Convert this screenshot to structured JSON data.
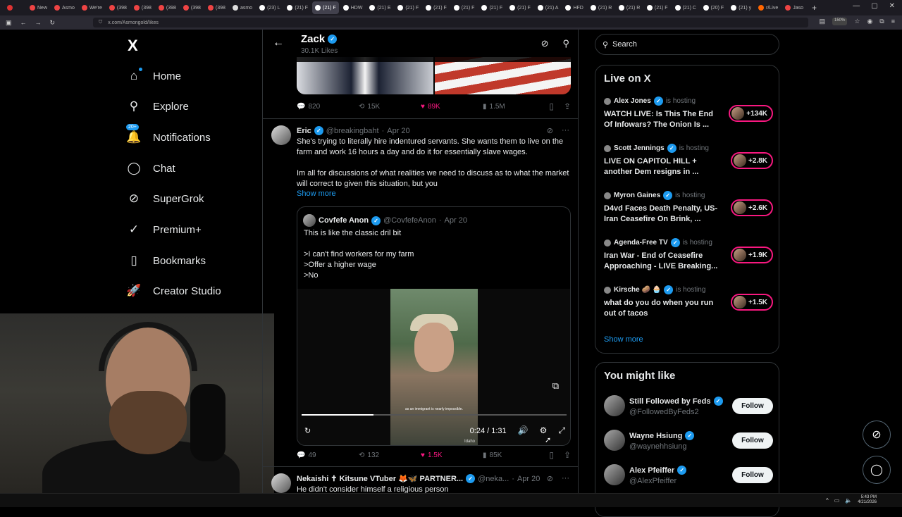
{
  "browser": {
    "tabs": [
      {
        "label": "",
        "color": "#d33"
      },
      {
        "label": "New",
        "color": "#e44"
      },
      {
        "label": "Asmo",
        "color": "#e44"
      },
      {
        "label": "We're",
        "color": "#e44"
      },
      {
        "label": "(398",
        "color": "#e44"
      },
      {
        "label": "(398",
        "color": "#e44"
      },
      {
        "label": "(398",
        "color": "#e44"
      },
      {
        "label": "(398",
        "color": "#e44"
      },
      {
        "label": "(398",
        "color": "#e44"
      },
      {
        "label": "asmo",
        "color": "#ddd"
      },
      {
        "label": "(23) L",
        "color": "#fff"
      },
      {
        "label": "(21) F",
        "color": "#fff"
      },
      {
        "label": "(21) F",
        "color": "#fff",
        "active": true
      },
      {
        "label": "HDW",
        "color": "#fff"
      },
      {
        "label": "(21) E",
        "color": "#fff"
      },
      {
        "label": "(21) F",
        "color": "#fff"
      },
      {
        "label": "(21) F",
        "color": "#fff"
      },
      {
        "label": "(21) F",
        "color": "#fff"
      },
      {
        "label": "(21) F",
        "color": "#fff"
      },
      {
        "label": "(21) F",
        "color": "#fff"
      },
      {
        "label": "(21) A",
        "color": "#fff"
      },
      {
        "label": "HFD",
        "color": "#fff"
      },
      {
        "label": "(21) R",
        "color": "#fff"
      },
      {
        "label": "(21) R",
        "color": "#fff"
      },
      {
        "label": "(21) F",
        "color": "#fff"
      },
      {
        "label": "(21) C",
        "color": "#fff"
      },
      {
        "label": "(20) F",
        "color": "#fff"
      },
      {
        "label": "(21) y",
        "color": "#fff"
      },
      {
        "label": "r/Live",
        "color": "#f60"
      },
      {
        "label": "Jaso",
        "color": "#e44"
      }
    ],
    "url": "x.com/Asmongold/likes",
    "zoom": "150%"
  },
  "nav": {
    "logo": "X",
    "items": [
      {
        "label": "Home",
        "icon": "⌂"
      },
      {
        "label": "Explore",
        "icon": "⚲"
      },
      {
        "label": "Notifications",
        "icon": "🔔",
        "badge": "20+"
      },
      {
        "label": "Chat",
        "icon": "◯"
      },
      {
        "label": "SuperGrok",
        "icon": "⊘"
      },
      {
        "label": "Premium+",
        "icon": "✓"
      },
      {
        "label": "Bookmarks",
        "icon": "▯"
      },
      {
        "label": "Creator Studio",
        "icon": "🚀"
      }
    ]
  },
  "profile_header": {
    "name": "Zack",
    "likes": "30.1K Likes"
  },
  "posts": [
    {
      "actions": {
        "replies": "820",
        "reposts": "15K",
        "likes": "89K",
        "views": "1.5M"
      }
    },
    {
      "name": "Eric",
      "handle": "@breakingbaht",
      "date": "Apr 20",
      "text1": "She's trying to literally hire indentured servants. She wants them to live on the farm and work 16 hours a day and do it for essentially slave wages.",
      "text2": "Im all for discussions of what realities we need to discuss as to what the market will correct to given this situation, but you",
      "show_more": "Show more",
      "quote": {
        "name": "Covfefe Anon",
        "handle": "@CovfefeAnon",
        "date": "Apr 20",
        "lines": [
          "This is like the classic dril bit",
          "",
          ">I can't find workers for my farm",
          ">Offer a higher wage",
          ">No"
        ],
        "video": {
          "time": "0:24 / 1:31",
          "progress": 0.27,
          "caption": "as an immigrant is nearly impossible.",
          "watermark": "Idaho"
        }
      },
      "actions": {
        "replies": "49",
        "reposts": "132",
        "likes": "1.5K",
        "views": "85K"
      }
    },
    {
      "name": "Nekaishi ✝ Kitsune VTuber 🦊🦋 PARTNER...",
      "handle": "@neka...",
      "date": "Apr 20",
      "text1": "He didn't consider himself a religious person"
    }
  ],
  "sidebar": {
    "search_placeholder": "Search",
    "live_title": "Live on X",
    "is_hosting": "is hosting",
    "live": [
      {
        "host": "Alex Jones",
        "title": "WATCH LIVE: Is This The End Of Infowars? The Onion Is ...",
        "count": "+134K"
      },
      {
        "host": "Scott Jennings",
        "title": "LIVE ON CAPITOL HILL + another Dem resigns in ...",
        "count": "+2.8K"
      },
      {
        "host": "Myron Gaines",
        "title": "D4vd Faces Death Penalty, US-Iran Ceasefire On Brink, ...",
        "count": "+2.6K"
      },
      {
        "host": "Agenda-Free TV",
        "title": "Iran War - End of Ceasefire Approaching - LIVE Breaking...",
        "count": "+1.9K"
      },
      {
        "host": "Kirsche 🥔 🧁",
        "title": "what do you do when you run out of tacos",
        "count": "+1.5K"
      }
    ],
    "live_show_more": "Show more",
    "wtf_title": "You might like",
    "follow_label": "Follow",
    "wtf": [
      {
        "name": "Still Followed by Feds",
        "handle": "@FollowedByFeds2"
      },
      {
        "name": "Wayne Hsiung",
        "handle": "@waynehhsiung"
      },
      {
        "name": "Alex Pfeiffer",
        "handle": "@AlexPfeiffer"
      }
    ]
  },
  "taskbar": {
    "time": "5:43 PM",
    "date": "4/21/2026"
  }
}
